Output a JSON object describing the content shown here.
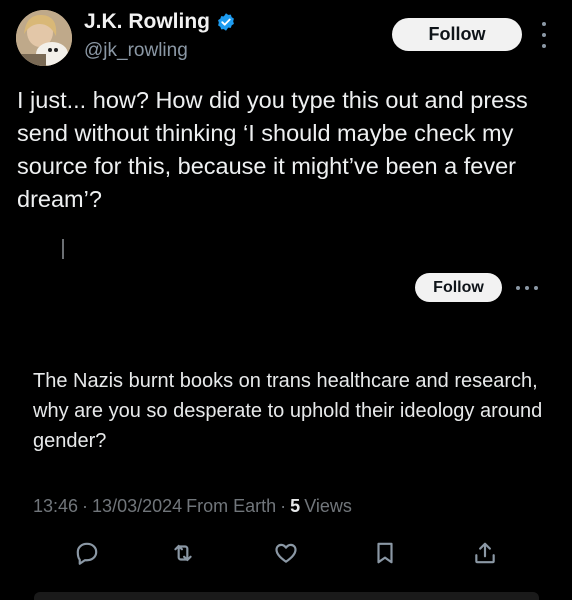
{
  "author": {
    "display_name": "J.K. Rowling",
    "handle": "@jk_rowling",
    "verified": true
  },
  "follow_label": "Follow",
  "tweet_text": "I just... how? How did you type this out and press send without thinking ‘I should maybe check my source for this, because it might’ve been a fever dream’?",
  "embed": {
    "follow_label": "Follow",
    "quote_text": "The Nazis burnt books on trans healthcare and research, why are you so desperate to uphold their ideology around gender?"
  },
  "meta": {
    "time": "13:46",
    "sep1": "·",
    "date": "13/03/2024",
    "source": "From Earth",
    "sep2": "·",
    "views_count": "5",
    "views_label": "Views"
  },
  "colors": {
    "background": "#000000",
    "text": "#e7e9ea",
    "secondary": "#71767b",
    "verified": "#1d9bf0",
    "button_bg": "#f2f2f2"
  },
  "icons": [
    "verified-icon",
    "more-icon",
    "reply-icon",
    "retweet-icon",
    "like-icon",
    "bookmark-icon",
    "share-icon"
  ]
}
